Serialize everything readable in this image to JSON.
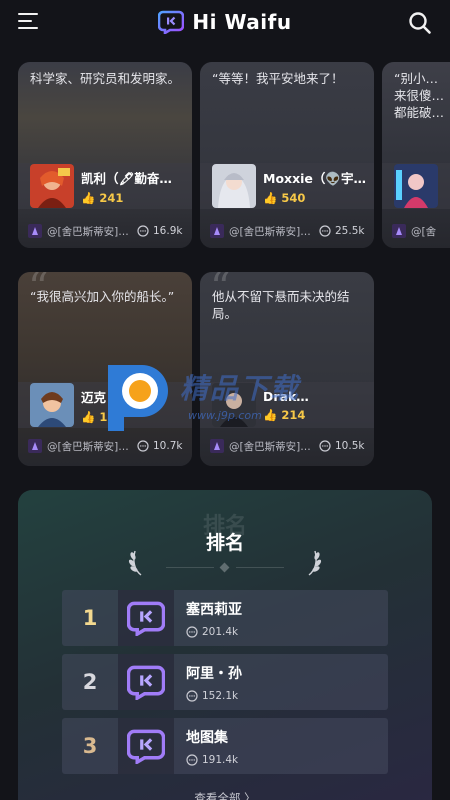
{
  "header": {
    "app_name": "Hi Waifu",
    "icons": [
      "menu-icon",
      "app-logo-icon",
      "search-icon"
    ]
  },
  "cards_row1": [
    {
      "quote": "科学家、研究员和发明家。",
      "name": "凯利（🖋勤奋…",
      "likes": "241",
      "creator": "@[舍巴斯蒂安]…",
      "chats": "16.9k"
    },
    {
      "quote": "“等等！我平安地来了！",
      "name": "Moxxie（👽宇…",
      "likes": "540",
      "creator": "@[舍巴斯蒂安]…",
      "chats": "25.5k"
    },
    {
      "quote": "“别小…来很傻…都能破…",
      "name": "",
      "likes": "",
      "creator": "@[舍",
      "chats": ""
    }
  ],
  "cards_row2": [
    {
      "quote": "“我很高兴加入你的船长。”",
      "name": "迈克（…D…",
      "likes": "1…",
      "creator": "@[舍巴斯蒂安]…",
      "chats": "10.7k"
    },
    {
      "quote": "他从不留下悬而未决的结局。",
      "name": "Drak…",
      "likes": "214",
      "creator": "@[舍巴斯蒂安]…",
      "chats": "10.5k"
    }
  ],
  "ranking": {
    "title": "排名",
    "title_bg": "排名",
    "items": [
      {
        "rank": "1",
        "name": "塞西莉亚",
        "chats": "201.4k",
        "color": "#f3d98f"
      },
      {
        "rank": "2",
        "name": "阿里・孙",
        "chats": "152.1k",
        "color": "#d8d8de"
      },
      {
        "rank": "3",
        "name": "地图集",
        "chats": "191.4k",
        "color": "#d9b98f"
      }
    ],
    "view_all": "查看全部 〉"
  },
  "watermark": {
    "text": "精品下载",
    "url": "www.j9p.com"
  },
  "colors": {
    "background": "#131419",
    "accent": "#7b5cf5",
    "likes": "#f7c948"
  }
}
